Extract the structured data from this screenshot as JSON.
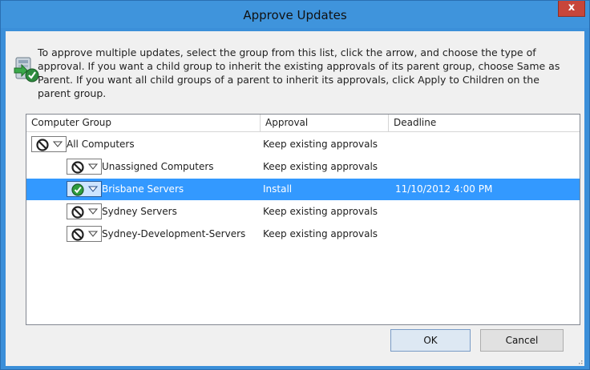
{
  "window": {
    "title": "Approve Updates",
    "close_glyph": "x"
  },
  "instructions": "To approve multiple updates, select the group from this list, click the arrow, and choose the type of approval. If you want a child group to inherit the existing approvals of its parent group, choose Same as Parent. If you want all child groups of a parent to inherit its approvals, click Apply to Children on the parent group.",
  "icons": {
    "dialog": "approve-updates-icon",
    "not_approved": "no-entry-icon",
    "approved": "check-circle-icon",
    "dropdown": "triangle-down-icon"
  },
  "table": {
    "columns": [
      "Computer Group",
      "Approval",
      "Deadline"
    ],
    "rows": [
      {
        "group": "All Computers",
        "approval": "Keep existing approvals",
        "deadline": "",
        "status": "not_approved",
        "level": 0,
        "selected": false
      },
      {
        "group": "Unassigned Computers",
        "approval": "Keep existing approvals",
        "deadline": "",
        "status": "not_approved",
        "level": 1,
        "selected": false
      },
      {
        "group": "Brisbane Servers",
        "approval": "Install",
        "deadline": "11/10/2012 4:00 PM",
        "status": "approved",
        "level": 1,
        "selected": true
      },
      {
        "group": "Sydney Servers",
        "approval": "Keep existing approvals",
        "deadline": "",
        "status": "not_approved",
        "level": 1,
        "selected": false
      },
      {
        "group": "Sydney-Development-Servers",
        "approval": "Keep existing approvals",
        "deadline": "",
        "status": "not_approved",
        "level": 1,
        "selected": false
      }
    ]
  },
  "buttons": {
    "ok": "OK",
    "cancel": "Cancel"
  },
  "colors": {
    "titlebar": "#3f94dc",
    "selection": "#3399ff",
    "close": "#c7463a"
  }
}
